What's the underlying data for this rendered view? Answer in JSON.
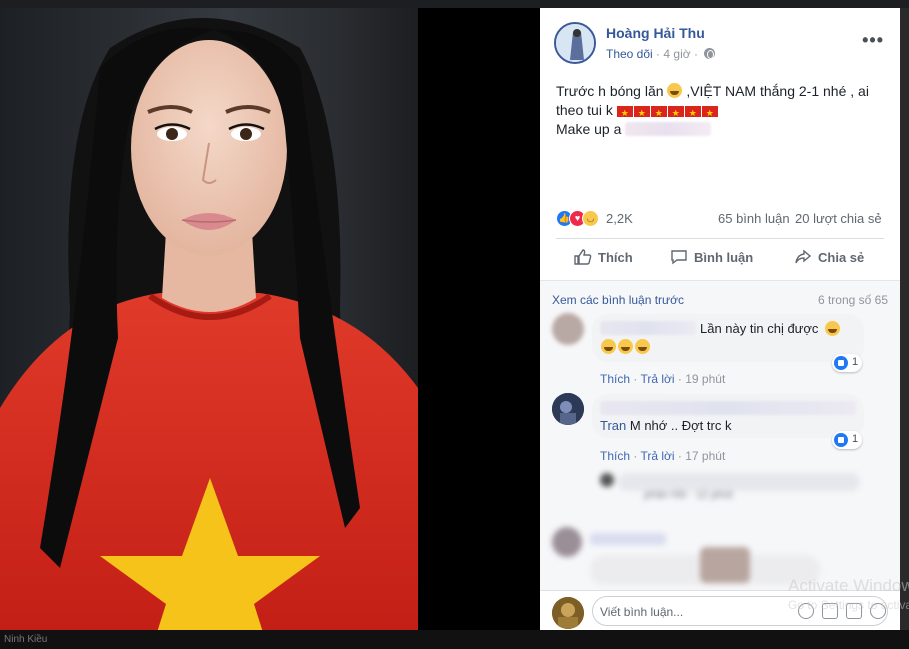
{
  "background": {
    "bottom_text": "Ninh Kiều"
  },
  "post": {
    "author": "Hoàng Hải Thu",
    "follow_label": "Theo dõi",
    "separator": "·",
    "time": "4 giờ",
    "more_label": "•••",
    "text_line1": "Trước h bóng lăn",
    "text_line1b": ",VIỆT NAM thắng 2-1 nhé , ai",
    "text_line2": "theo tui k",
    "text_line3": "Make up a"
  },
  "reactions": {
    "count": "2,2K",
    "comments": "65 bình luận",
    "shares": "20 lượt chia sẻ"
  },
  "actions": {
    "like": "Thích",
    "comment": "Bình luận",
    "share": "Chia sẻ"
  },
  "comments": {
    "view_previous": "Xem các bình luận trước",
    "count_of": "6 trong số 65",
    "items": [
      {
        "text": "Lần này tin chị được",
        "like_label": "Thích",
        "reply_label": "Trả lời",
        "time": "19 phút",
        "reaction_count": "1"
      },
      {
        "name_visible": "Tran",
        "text": "M nhớ .. Đợt trc k",
        "like_label": "Thích",
        "reply_label": "Trả lời",
        "time": "17 phút",
        "reaction_count": "1"
      }
    ],
    "reply_hint": "phản hồi · 12 phút"
  },
  "composer": {
    "placeholder": "Viết bình luận..."
  },
  "watermark": {
    "line1": "Activate Windows",
    "line2": "Go to Settings to activate Windows."
  },
  "colors": {
    "link": "#365899",
    "like_blue": "#2078f4",
    "text": "#1d2129",
    "muted": "#90949c",
    "shirt_red": "#d7261c",
    "star_yellow": "#f6c31a"
  }
}
